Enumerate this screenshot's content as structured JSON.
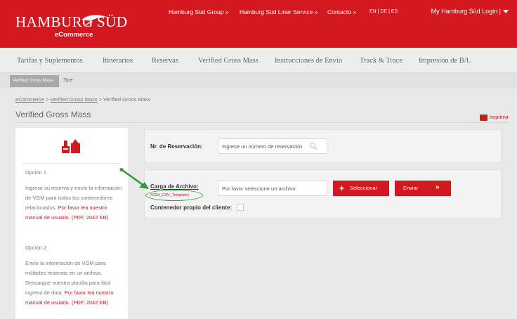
{
  "header": {
    "logo_left": "HAMBURG",
    "logo_right": "SÜD",
    "logo_sub": "eCommerce",
    "links": [
      "Hamburg Süd Group »",
      "Hamburg Süd Liner Service »",
      "Contacto »"
    ],
    "languages": "EN | DE | ES",
    "login": "My Hamburg Süd Login |"
  },
  "nav": {
    "items": [
      "Tarifas y Suplementos",
      "Itinerarios",
      "Reservas",
      "Verified Gross Mass",
      "Instrucciones de Envío",
      "Track & Trace",
      "Impresión de B/L"
    ]
  },
  "subnav": {
    "active": "Verified Gross Mass",
    "other": "Tare"
  },
  "breadcrumb": {
    "home": "eCommerce",
    "sep1": " > ",
    "section": "Verified Gross Mass",
    "sep2": " > ",
    "current": "Verified Gross Mass"
  },
  "page": {
    "title": "Verified Gross Mass",
    "print": "Imprimir"
  },
  "left_panel": {
    "option1_title": "Opción 1",
    "option1_text": "Ingrese su reserva y envíe la información de VGM para todos los contenedores relacionados.",
    "option1_link": "Por favor lea nuestro manual de usuario. (PDF, 2042 KB)",
    "option2_title": "Opción 2",
    "option2_text": "Envíe la información de VGM para múltiples reservas en un archivo. Descargue nuestra planilla para fácil ingreso de data.",
    "option2_link": "Por favor lea nuestro manual de usuario. (PDF, 2042 KB)"
  },
  "form": {
    "booking_label": "Nr. de Reservación:",
    "booking_placeholder": "Ingrese un número de reservación",
    "file_label": "Carga de Archivo:",
    "template_link": "(VGM_CSV_Template)",
    "file_placeholder": "Por favor seleccione un archivo",
    "select_button": "Seleccionar",
    "send_button": "Enviar",
    "own_container_label": "Contenedor propio del cliente:"
  },
  "colors": {
    "brand_red": "#d3191f",
    "annotation_green": "#2e9b3c"
  }
}
